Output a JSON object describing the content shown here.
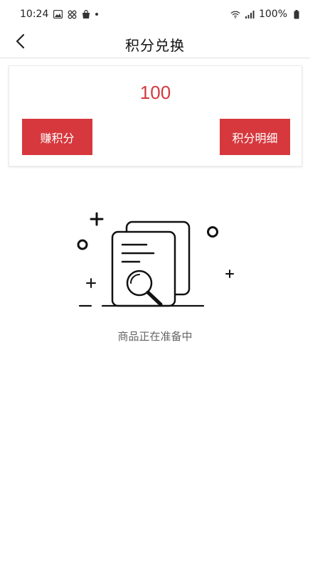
{
  "status_bar": {
    "time": "10:24",
    "battery": "100%",
    "icons_left": [
      "image-icon",
      "grid-icon",
      "bag-icon",
      "dot-icon"
    ],
    "icons_right": [
      "wifi-icon",
      "signal-icon",
      "battery-icon"
    ]
  },
  "nav": {
    "title": "积分兑换",
    "back_icon": "chevron-left-icon"
  },
  "points_card": {
    "value": "100",
    "earn_label": "赚积分",
    "detail_label": "积分明细"
  },
  "empty_state": {
    "message": "商品正在准备中",
    "illustration_icon": "document-search-icon"
  },
  "colors": {
    "accent": "#d6383d",
    "points_text": "#d43a3f"
  }
}
